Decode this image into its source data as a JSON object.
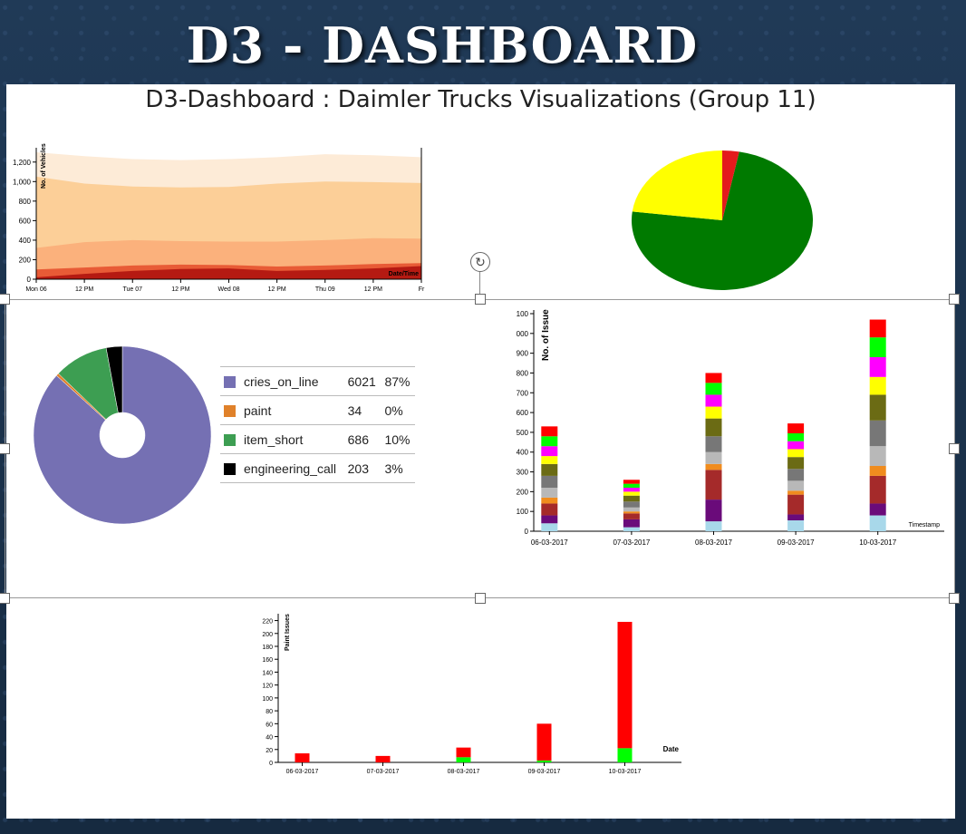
{
  "banner": "D3 - DASHBOARD",
  "slide_title": "D3-Dashboard : Daimler Trucks Visualizations (Group 11)",
  "colors": {
    "streams": [
      "#fdebd7",
      "#fccf98",
      "#fbb17c",
      "#e85b36",
      "#b51a12"
    ],
    "pie_green": "#007a00",
    "pie_yellow": "#ffff00",
    "pie_red": "#e41a1c",
    "donut": [
      "#7570b3",
      "#e0812a",
      "#3d9e52",
      "#000000"
    ],
    "stack": [
      "#a8d8ea",
      "#6a0b7a",
      "#a52a2a",
      "#f08c1e",
      "#b8b8b8",
      "#777777",
      "#6b6b14",
      "#ffff00",
      "#ff00ff",
      "#00ff00",
      "#ff0000"
    ],
    "paint_red": "#ff0000",
    "paint_green": "#00ff00"
  },
  "rotate_icon": "↻",
  "chart_data": [
    {
      "type": "area",
      "ylabel": "No. of Vehicles",
      "xlabel": "Date/Time",
      "ylim": [
        0,
        1300
      ],
      "y_ticks": [
        "0",
        "200",
        "400",
        "600",
        "800",
        "1,000",
        "1,200"
      ],
      "x_ticks": [
        "Mon 06",
        "12 PM",
        "Tue 07",
        "12 PM",
        "Wed 08",
        "12 PM",
        "Thu 09",
        "12 PM",
        "Fr"
      ],
      "x": [
        0,
        1,
        2,
        3,
        4,
        5,
        6,
        7,
        8
      ],
      "stacked_tops": [
        [
          20,
          55,
          85,
          105,
          110,
          85,
          95,
          110,
          135
        ],
        [
          100,
          120,
          140,
          150,
          145,
          130,
          140,
          155,
          165
        ],
        [
          320,
          380,
          400,
          390,
          385,
          385,
          400,
          420,
          415
        ],
        [
          1050,
          980,
          950,
          940,
          945,
          980,
          1000,
          995,
          985
        ],
        [
          1300,
          1260,
          1230,
          1220,
          1230,
          1250,
          1280,
          1270,
          1250
        ]
      ]
    },
    {
      "type": "pie",
      "values": [
        74,
        23,
        3
      ],
      "colors_key": [
        "pie_green",
        "pie_yellow",
        "pie_red"
      ]
    },
    {
      "type": "pie",
      "donut": true,
      "labels": [
        "cries_on_line",
        "paint",
        "item_short",
        "engineering_call"
      ],
      "values": [
        6021,
        34,
        686,
        203
      ],
      "percents": [
        "87%",
        "0%",
        "10%",
        "3%"
      ]
    },
    {
      "type": "bar",
      "stacked": true,
      "ylabel": "No. of Issue",
      "xlabel": "Timestamp",
      "ylim": [
        0,
        1100
      ],
      "y_ticks": [
        "0",
        "100",
        "200",
        "300",
        "400",
        "500",
        "600",
        "700",
        "800",
        "900",
        "000",
        "100"
      ],
      "categories": [
        "06-03-2017",
        "07-03-2017",
        "08-03-2017",
        "09-03-2017",
        "10-03-2017"
      ],
      "stacks": [
        [
          40,
          40,
          60,
          30,
          50,
          60,
          60,
          40,
          50,
          50,
          50
        ],
        [
          20,
          40,
          30,
          10,
          20,
          30,
          30,
          20,
          20,
          20,
          20
        ],
        [
          50,
          110,
          150,
          30,
          60,
          80,
          90,
          60,
          60,
          60,
          50
        ],
        [
          55,
          30,
          100,
          20,
          50,
          60,
          60,
          40,
          40,
          40,
          50
        ],
        [
          80,
          60,
          140,
          50,
          100,
          130,
          130,
          90,
          100,
          100,
          90
        ]
      ]
    },
    {
      "type": "bar",
      "stacked": true,
      "ylabel": "Paint Issues",
      "xlabel": "Date",
      "ylim": [
        0,
        225
      ],
      "y_ticks": [
        "0",
        "20",
        "40",
        "60",
        "80",
        "100",
        "120",
        "140",
        "160",
        "180",
        "200",
        "220"
      ],
      "categories": [
        "06-03-2017",
        "07-03-2017",
        "08-03-2017",
        "09-03-2017",
        "10-03-2017"
      ],
      "series": [
        {
          "values": [
            0,
            0,
            8,
            3,
            22
          ]
        },
        {
          "values": [
            14,
            10,
            15,
            57,
            196
          ]
        }
      ]
    }
  ],
  "legend": [
    {
      "label": "cries_on_line",
      "count": "6021",
      "pct": "87%"
    },
    {
      "label": "paint",
      "count": "34",
      "pct": "0%"
    },
    {
      "label": "item_short",
      "count": "686",
      "pct": "10%"
    },
    {
      "label": "engineering_call",
      "count": "203",
      "pct": "3%"
    }
  ]
}
